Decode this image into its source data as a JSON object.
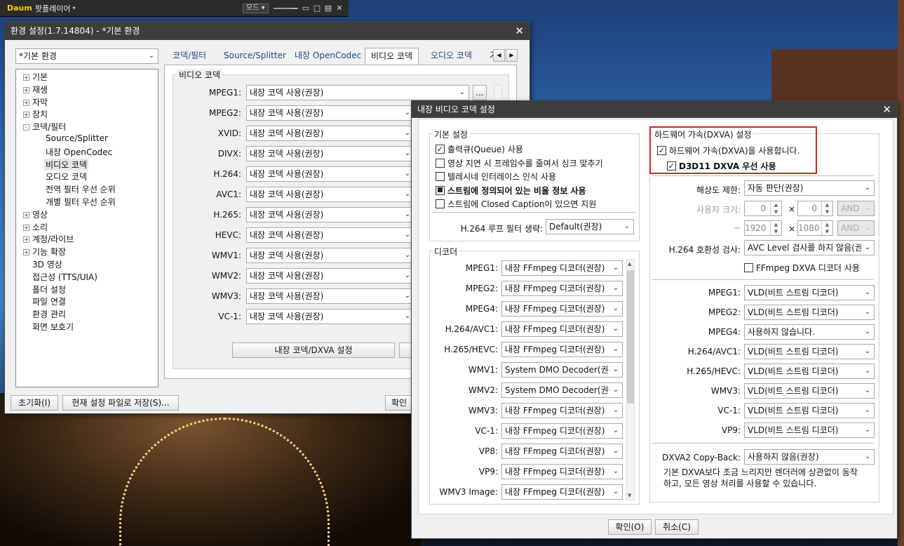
{
  "player_bar": {
    "logo": "Daum",
    "app_name": "팟플레이어",
    "mode_label": "모드"
  },
  "settings_window": {
    "title": "환경 설정(1.7.14804) - *기본 환경",
    "profile_select": "*기본 환경",
    "tree": [
      {
        "label": "기본",
        "level": 0,
        "expand": "+"
      },
      {
        "label": "재생",
        "level": 0,
        "expand": "+"
      },
      {
        "label": "자막",
        "level": 0,
        "expand": "+"
      },
      {
        "label": "장치",
        "level": 0,
        "expand": "+"
      },
      {
        "label": "코덱/필터",
        "level": 0,
        "expand": "-"
      },
      {
        "label": "Source/Splitter",
        "level": 1,
        "expand": ""
      },
      {
        "label": "내장 OpenCodec",
        "level": 1,
        "expand": ""
      },
      {
        "label": "비디오 코덱",
        "level": 1,
        "expand": "",
        "selected": true
      },
      {
        "label": "오디오 코덱",
        "level": 1,
        "expand": ""
      },
      {
        "label": "전역 필터 우선 순위",
        "level": 1,
        "expand": ""
      },
      {
        "label": "개별 필터 우선 순위",
        "level": 1,
        "expand": ""
      },
      {
        "label": "영상",
        "level": 0,
        "expand": "+"
      },
      {
        "label": "소리",
        "level": 0,
        "expand": "+"
      },
      {
        "label": "계정/라이브",
        "level": 0,
        "expand": "+"
      },
      {
        "label": "기능 확장",
        "level": 0,
        "expand": "+"
      },
      {
        "label": "3D 영상",
        "level": 0,
        "expand": ""
      },
      {
        "label": "접근성 (TTS/UIA)",
        "level": 0,
        "expand": ""
      },
      {
        "label": "폴더 설정",
        "level": 0,
        "expand": ""
      },
      {
        "label": "파일 연결",
        "level": 0,
        "expand": ""
      },
      {
        "label": "환경 관리",
        "level": 0,
        "expand": ""
      },
      {
        "label": "화면 보호기",
        "level": 0,
        "expand": ""
      }
    ],
    "tabs": [
      "코덱/필터",
      "Source/Splitter",
      "내장 OpenCodec",
      "비디오 코덱",
      "오디오 코덱"
    ],
    "active_tab": "비디오 코덱",
    "group_title": "비디오 코덱",
    "codecs": [
      {
        "name": "MPEG1:",
        "value": "내장 코덱 사용(권장)"
      },
      {
        "name": "MPEG2:",
        "value": "내장 코덱 사용(권장)"
      },
      {
        "name": "XVID:",
        "value": "내장 코덱 사용(권장)"
      },
      {
        "name": "DIVX:",
        "value": "내장 코덱 사용(권장)"
      },
      {
        "name": "H.264:",
        "value": "내장 코덱 사용(권장)"
      },
      {
        "name": "AVC1:",
        "value": "내장 코덱 사용(권장)"
      },
      {
        "name": "H.265:",
        "value": "내장 코덱 사용(권장)"
      },
      {
        "name": "HEVC:",
        "value": "내장 코덱 사용(권장)"
      },
      {
        "name": "WMV1:",
        "value": "내장 코덱 사용(권장)"
      },
      {
        "name": "WMV2:",
        "value": "내장 코덱 사용(권장)"
      },
      {
        "name": "WMV3:",
        "value": "내장 코덱 사용(권장)"
      },
      {
        "name": "VC-1:",
        "value": "내장 코덱 사용(권장)"
      }
    ],
    "more_button": "...",
    "dxva_button": "내장 코덱/DXVA 설정",
    "reset_button": "초기화(I)",
    "save_button": "현재 설정 파일로 저장(S)...",
    "ok_button": "확인"
  },
  "dialog": {
    "title": "내장 비디오 코덱 설정",
    "basic": {
      "title": "기본 설정",
      "options": [
        {
          "label": "출력큐(Queue) 사용",
          "checked": "on",
          "bold": false
        },
        {
          "label": "영상 지연 시 프레임수를 줄여서 싱크 맞추기",
          "checked": "off",
          "bold": false
        },
        {
          "label": "텔레시네 인터레이스 인식 사용",
          "checked": "off",
          "bold": false
        },
        {
          "label": "스트림에 정의되어 있는 비율 정보 사용",
          "checked": "partial",
          "bold": true
        },
        {
          "label": "스트림에 Closed Caption이 있으면 지원",
          "checked": "off",
          "bold": false
        }
      ],
      "loop_filter_label": "H.264 루프 필터 생략:",
      "loop_filter_value": "Default(권장)"
    },
    "decoder": {
      "title": "디코더",
      "items": [
        {
          "name": "MPEG1:",
          "value": "내장 FFmpeg 디코더(권장)"
        },
        {
          "name": "MPEG2:",
          "value": "내장 FFmpeg 디코더(권장)"
        },
        {
          "name": "MPEG4:",
          "value": "내장 FFmpeg 디코더(권장)"
        },
        {
          "name": "H.264/AVC1:",
          "value": "내장 FFmpeg 디코더(권장)"
        },
        {
          "name": "H.265/HEVC:",
          "value": "내장 FFmpeg 디코더(권장)"
        },
        {
          "name": "WMV1:",
          "value": "System DMO Decoder(권장"
        },
        {
          "name": "WMV2:",
          "value": "System DMO Decoder(권장"
        },
        {
          "name": "WMV3:",
          "value": "내장 FFmpeg 디코더(권장)"
        },
        {
          "name": "VC-1:",
          "value": "내장 FFmpeg 디코더(권장)"
        },
        {
          "name": "VP8:",
          "value": "내장 FFmpeg 디코더(권장)"
        },
        {
          "name": "VP9:",
          "value": "내장 FFmpeg 디코더(권장)"
        },
        {
          "name": "WMV3 Image:",
          "value": "내장 FFmpeg 디코더(권장)"
        }
      ]
    },
    "hw": {
      "title": "하드웨어 가속(DXVA) 설정",
      "use_hw": "하드웨어 가속(DXVA)을 사용합니다.",
      "d3d11": "D3D11 DXVA 우선 사용",
      "res_label": "해상도 제한:",
      "res_value": "자동 판단(권장)",
      "user_size_label": "사용자 크기:",
      "w1": "0",
      "h1": "0",
      "and1": "AND",
      "tilde": "~",
      "w2": "1920",
      "h2": "1080",
      "and2": "AND",
      "times": "×",
      "compat_label": "H.264 호환성 검사:",
      "compat_value": "AVC Level 검사를 하지 않음(권",
      "ffmpeg_dxva": "FFmpeg DXVA 디코더 사용",
      "codecs": [
        {
          "name": "MPEG1:",
          "value": "VLD(비트 스트림 디코더)"
        },
        {
          "name": "MPEG2:",
          "value": "VLD(비트 스트림 디코더)"
        },
        {
          "name": "MPEG4:",
          "value": "사용하지 않습니다."
        },
        {
          "name": "H.264/AVC1:",
          "value": "VLD(비트 스트림 디코더)"
        },
        {
          "name": "H.265/HEVC:",
          "value": "VLD(비트 스트림 디코더)"
        },
        {
          "name": "WMV3:",
          "value": "VLD(비트 스트림 디코더)"
        },
        {
          "name": "VC-1:",
          "value": "VLD(비트 스트림 디코더)"
        },
        {
          "name": "VP9:",
          "value": "VLD(비트 스트림 디코더)"
        }
      ],
      "copyback_label": "DXVA2 Copy-Back:",
      "copyback_value": "사용하지 않음(권장)",
      "note_line1": "기본 DXVA보다 조금 느리지만 렌더러에 상관없이 동작",
      "note_line2": "하고, 모든 영상 처리를 사용할 수 있습니다."
    },
    "ok": "확인(O)",
    "cancel": "취소(C)"
  }
}
